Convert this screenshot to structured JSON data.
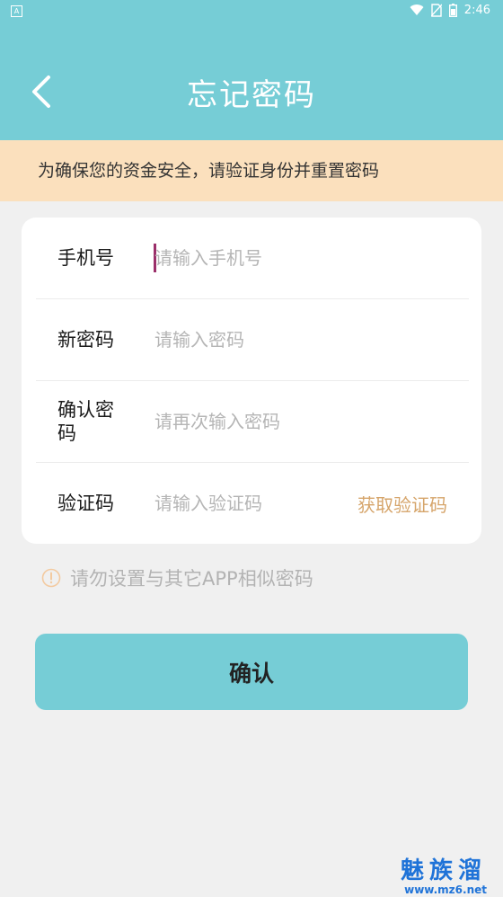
{
  "status_bar": {
    "notification_glyph": "A",
    "time": "2:46",
    "icons": [
      "wifi-icon",
      "no-sim-icon",
      "battery-icon"
    ]
  },
  "header": {
    "title": "忘记密码",
    "back_icon": "chevron-left-icon"
  },
  "notice": {
    "text": "为确保您的资金安全，请验证身份并重置密码"
  },
  "form": {
    "phone": {
      "label": "手机号",
      "placeholder": "请输入手机号",
      "value": ""
    },
    "new_password": {
      "label": "新密码",
      "placeholder": "请输入密码",
      "value": ""
    },
    "confirm_password": {
      "label": "确认密码",
      "placeholder": "请再次输入密码",
      "value": ""
    },
    "code": {
      "label": "验证码",
      "placeholder": "请输入验证码",
      "value": "",
      "get_code_label": "获取验证码"
    }
  },
  "tip": {
    "icon": "exclamation-circle-icon",
    "text": "请勿设置与其它APP相似密码"
  },
  "confirm_button": {
    "label": "确认"
  },
  "watermark": {
    "name": "魅族溜",
    "url": "www.mz6.net"
  },
  "colors": {
    "header_bg": "#76cdd6",
    "notice_bg": "#fbe0bd",
    "page_bg": "#f0f0f0",
    "get_code_text": "#d6a56b",
    "caret": "#9b2f6a",
    "watermark": "#1f73d8"
  }
}
